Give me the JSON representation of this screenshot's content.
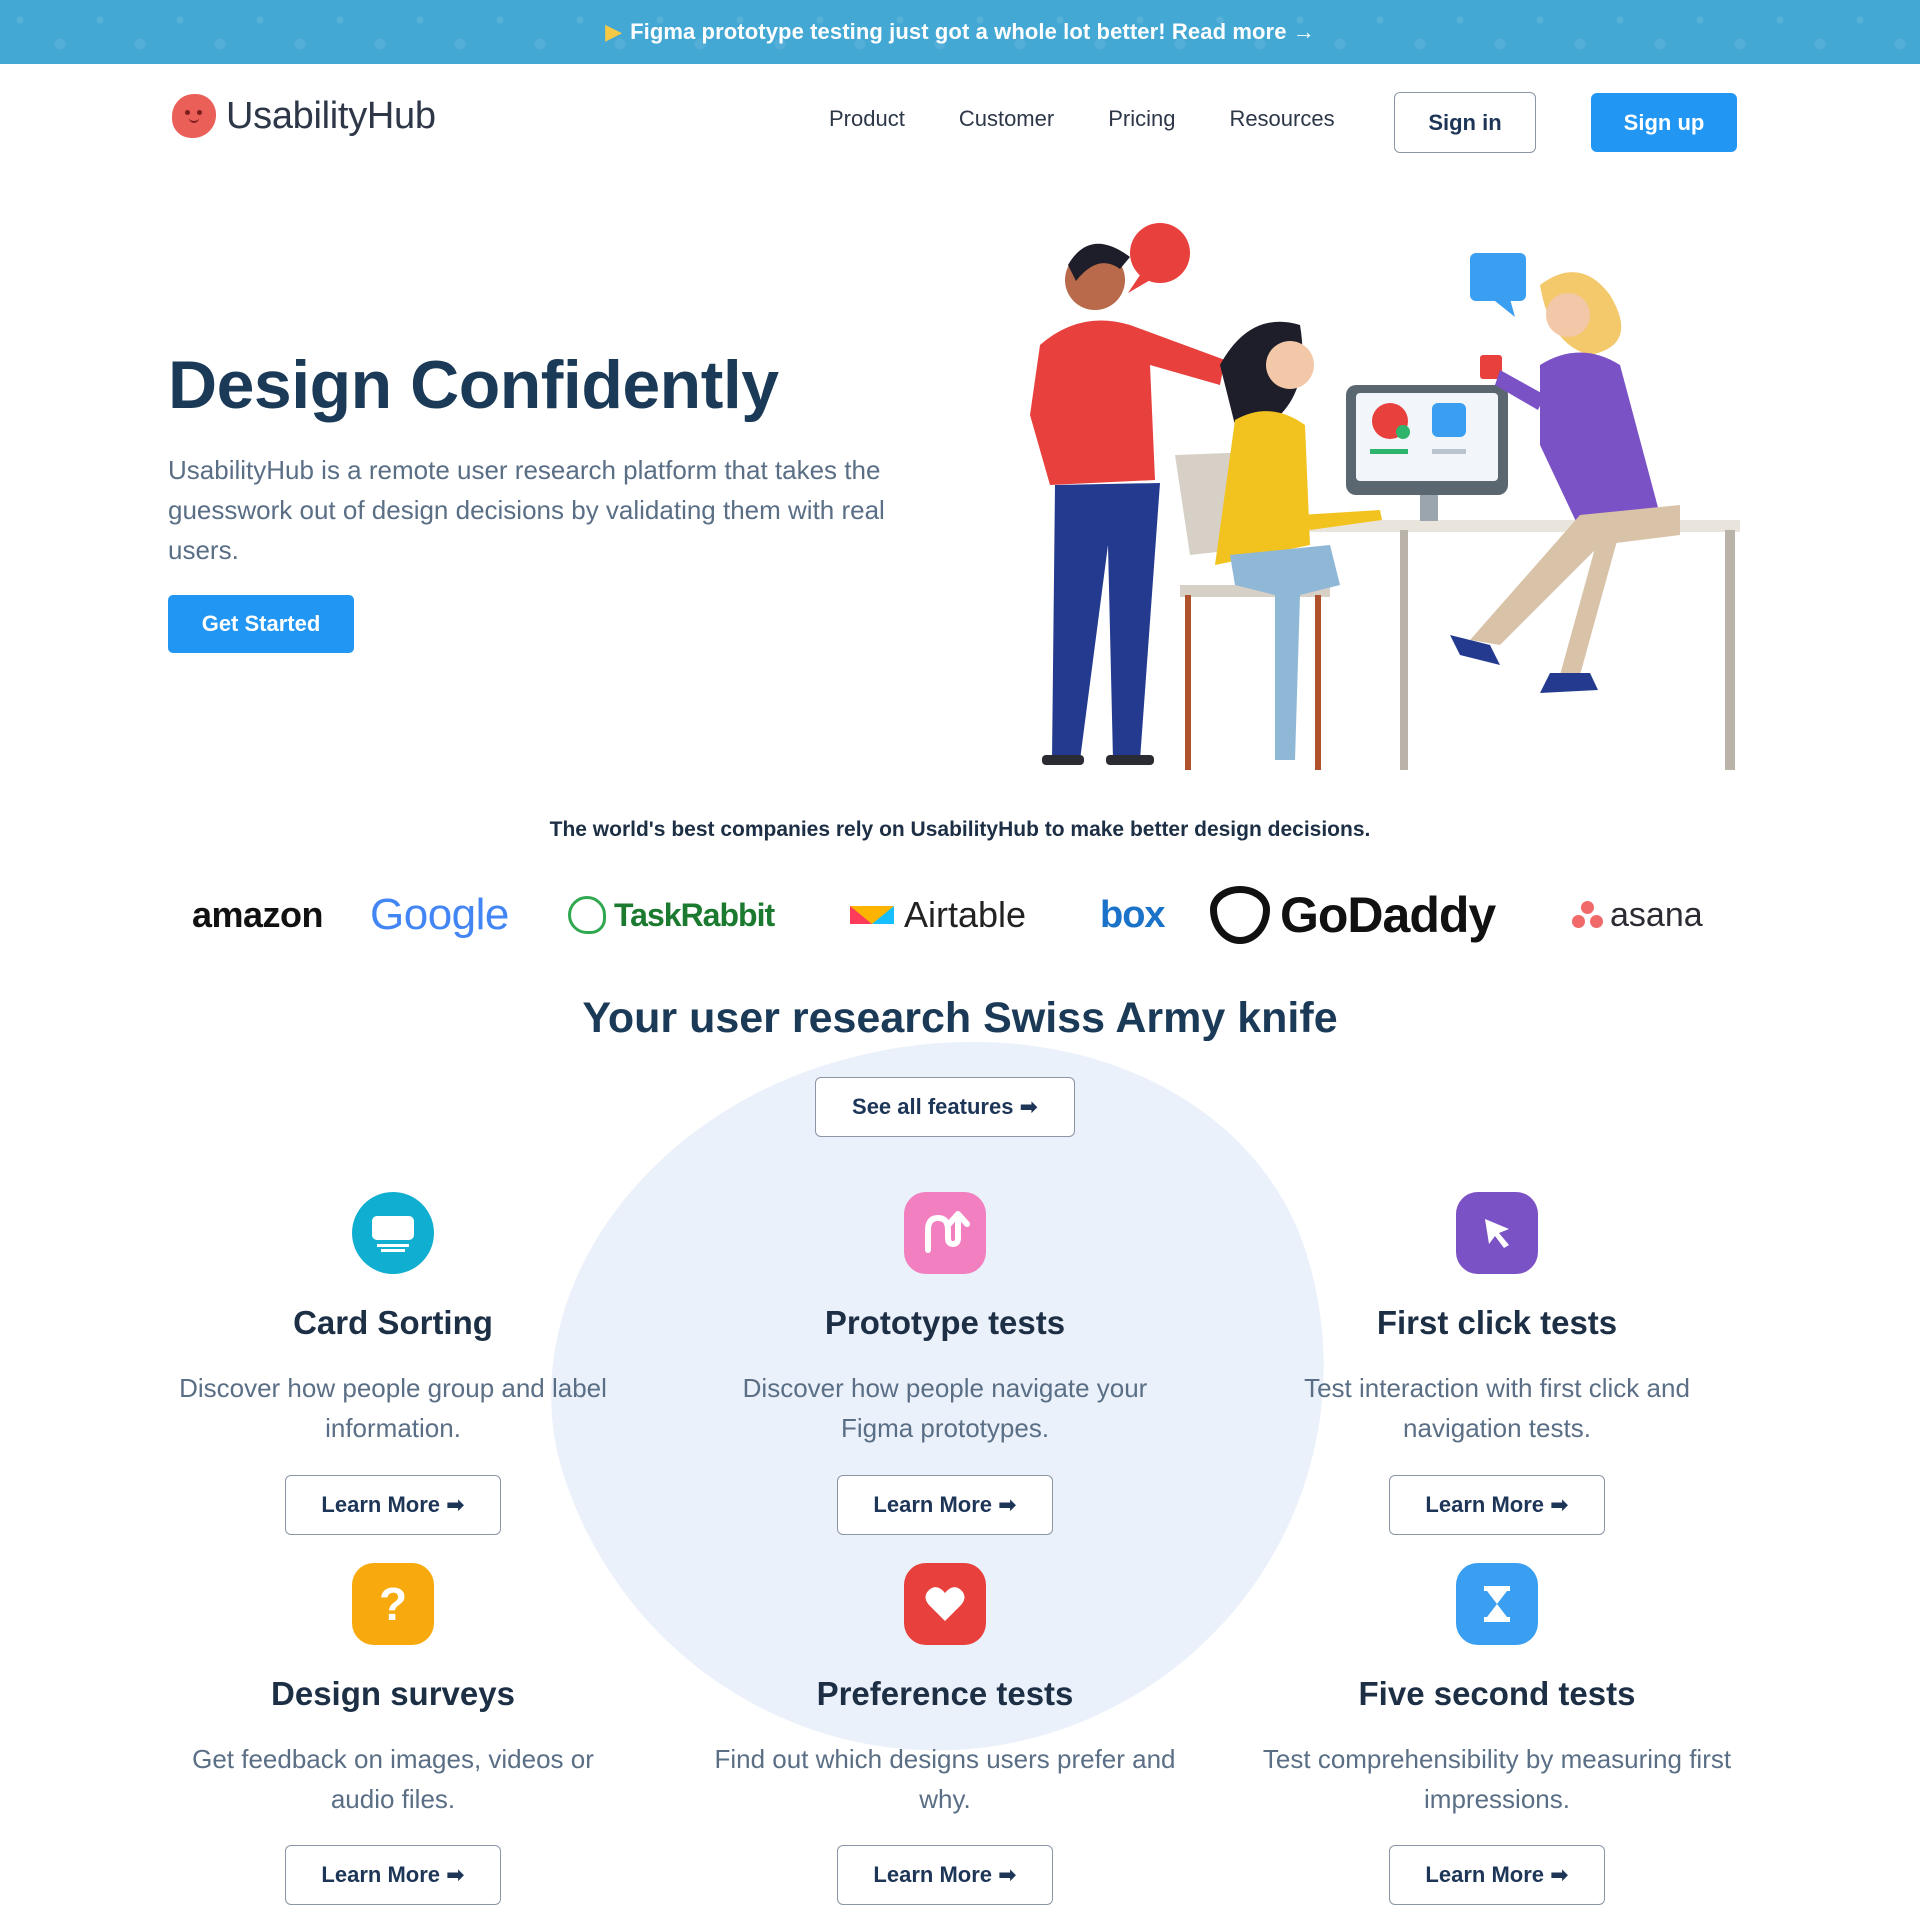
{
  "banner": {
    "text": "Figma prototype testing just got a whole lot better! Read more →",
    "icon": "megaphone-icon"
  },
  "header": {
    "logo_text": "UsabilityHub",
    "nav": [
      "Product",
      "Customer",
      "Pricing",
      "Resources"
    ],
    "sign_in": "Sign in",
    "sign_up": "Sign up"
  },
  "hero": {
    "title": "Design Confidently",
    "description": "UsabilityHub is a remote user research platform that takes the guesswork out of design decisions by validating them with real users.",
    "cta": "Get Started"
  },
  "trusted": {
    "text": "The world's best companies rely on UsabilityHub to make better design decisions.",
    "companies": [
      "amazon",
      "Google",
      "TaskRabbit",
      "Airtable",
      "box",
      "GoDaddy",
      "asana"
    ]
  },
  "features": {
    "title": "Your user research Swiss Army knife",
    "see_all": "See all features ➡",
    "items": [
      {
        "title": "Card Sorting",
        "description": "Discover how people group and label information.",
        "button": "Learn More ➡",
        "icon": "monitor-icon",
        "color": "#10aed0"
      },
      {
        "title": "Prototype tests",
        "description": "Discover how people navigate your Figma prototypes.",
        "button": "Learn More ➡",
        "icon": "prototype-arrow-icon",
        "color": "#f27fbf"
      },
      {
        "title": "First click tests",
        "description": "Test interaction with first click and navigation tests.",
        "button": "Learn More ➡",
        "icon": "cursor-icon",
        "color": "#7b52c6"
      },
      {
        "title": "Design surveys",
        "description": "Get feedback on images, videos or audio files.",
        "button": "Learn More ➡",
        "icon": "question-icon",
        "color": "#f7a90d"
      },
      {
        "title": "Preference tests",
        "description": "Find out which designs users prefer and why.",
        "button": "Learn More ➡",
        "icon": "heart-icon",
        "color": "#e8403d"
      },
      {
        "title": "Five second tests",
        "description": "Test comprehensibility by measuring first impressions.",
        "button": "Learn More ➡",
        "icon": "hourglass-icon",
        "color": "#3a9ff0"
      }
    ]
  },
  "colors": {
    "accent": "#2196f3",
    "banner": "#44a8d4",
    "heading": "#1b3a57"
  }
}
